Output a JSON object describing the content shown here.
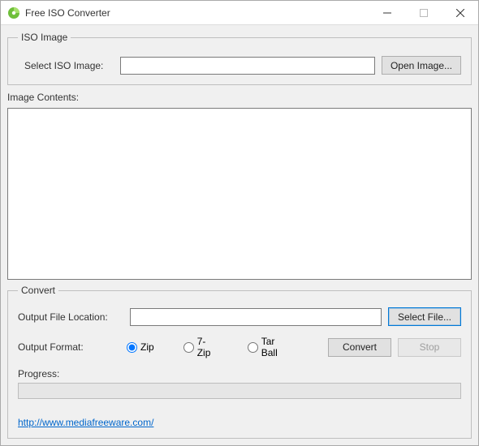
{
  "window": {
    "title": "Free ISO Converter"
  },
  "iso_group": {
    "legend": "ISO Image",
    "select_label": "Select ISO Image:",
    "path_value": "",
    "open_button": "Open Image..."
  },
  "contents": {
    "label": "Image Contents:"
  },
  "convert_group": {
    "legend": "Convert",
    "output_label": "Output File Location:",
    "output_value": "",
    "select_file_button": "Select File...",
    "format_label": "Output Format:",
    "formats": {
      "zip": "Zip",
      "sevenzip": "7-Zip",
      "tarball": "Tar Ball"
    },
    "selected_format": "zip",
    "convert_button": "Convert",
    "stop_button": "Stop",
    "progress_label": "Progress:",
    "progress_value": 0
  },
  "footer": {
    "link_text": "http://www.mediafreeware.com/"
  }
}
